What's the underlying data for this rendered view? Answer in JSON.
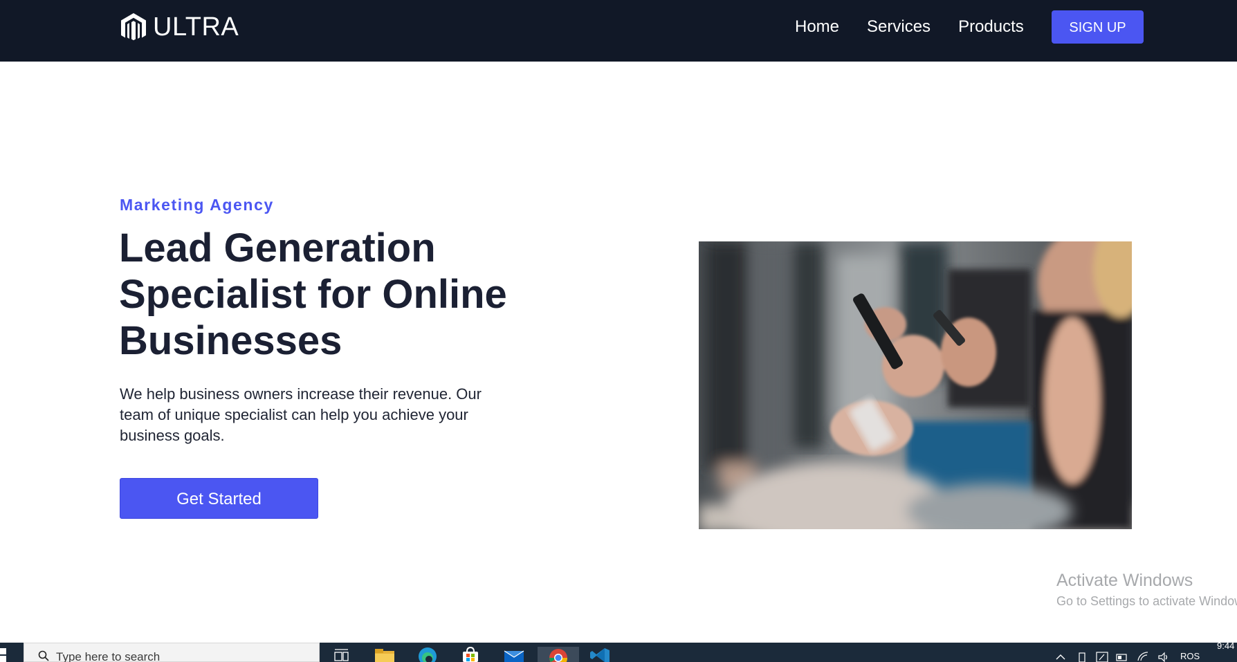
{
  "nav": {
    "brand": "ULTRA",
    "links": [
      "Home",
      "Services",
      "Products"
    ],
    "signup": "SIGN UP"
  },
  "hero": {
    "eyebrow": "Marketing Agency",
    "headline": "Lead Generation Specialist for Online Businesses",
    "lead": "We help business owners increase their revenue. Our team of unique specialist can help you achieve your business goals.",
    "cta": "Get Started",
    "image_icon": "photo-people-using-phones"
  },
  "watermark": {
    "title": "Activate Windows",
    "subtitle": "Go to Settings to activate Windows."
  },
  "taskbar": {
    "search_placeholder": "Type here to search",
    "apps": [
      "task-view-icon",
      "file-explorer-icon",
      "edge-icon",
      "store-icon",
      "mail-icon",
      "chrome-icon",
      "vscode-icon"
    ],
    "active_app": "chrome-icon",
    "language": "ROS",
    "time": "9:44"
  },
  "colors": {
    "nav_bg": "#111827",
    "accent": "#4b56f2",
    "heading": "#1b2033",
    "taskbar_bg": "#1b2a3a"
  }
}
